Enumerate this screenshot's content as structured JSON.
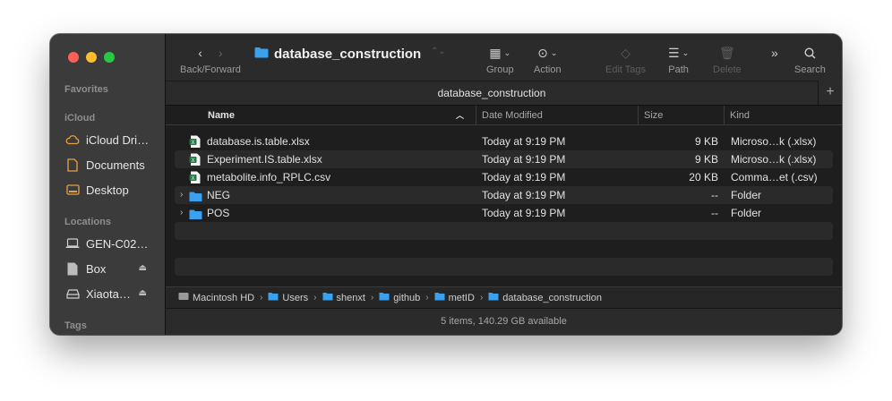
{
  "sidebar": {
    "sections": {
      "favorites": "Favorites",
      "icloud": "iCloud",
      "locations": "Locations",
      "tags": "Tags"
    },
    "icloud_items": [
      "iCloud Dri…",
      "Documents",
      "Desktop"
    ],
    "location_items": [
      "GEN-C02…",
      "Box",
      "Xiaota…"
    ]
  },
  "toolbar": {
    "nav_label": "Back/Forward",
    "title": "database_construction",
    "group_label": "Group",
    "action_label": "Action",
    "edit_tags_label": "Edit Tags",
    "path_label": "Path",
    "delete_label": "Delete",
    "search_label": "Search"
  },
  "tab_title": "database_construction",
  "columns": {
    "name": "Name",
    "date": "Date Modified",
    "size": "Size",
    "kind": "Kind"
  },
  "files": [
    {
      "name": "database.is.table.xlsx",
      "date": "Today at 9:19 PM",
      "size": "9 KB",
      "kind": "Microso…k (.xlsx)",
      "type": "xlsx"
    },
    {
      "name": "Experiment.IS.table.xlsx",
      "date": "Today at 9:19 PM",
      "size": "9 KB",
      "kind": "Microso…k (.xlsx)",
      "type": "xlsx"
    },
    {
      "name": "metabolite.info_RPLC.csv",
      "date": "Today at 9:19 PM",
      "size": "20 KB",
      "kind": "Comma…et (.csv)",
      "type": "csv"
    },
    {
      "name": "NEG",
      "date": "Today at 9:19 PM",
      "size": "--",
      "kind": "Folder",
      "type": "folder"
    },
    {
      "name": "POS",
      "date": "Today at 9:19 PM",
      "size": "--",
      "kind": "Folder",
      "type": "folder"
    }
  ],
  "breadcrumb": [
    "Macintosh HD",
    "Users",
    "shenxt",
    "github",
    "metID",
    "database_construction"
  ],
  "status": "5 items, 140.29 GB available",
  "colors": {
    "folder": "#3aa0f0",
    "excel": "#1f7a45",
    "accent": "#e6a23c"
  }
}
